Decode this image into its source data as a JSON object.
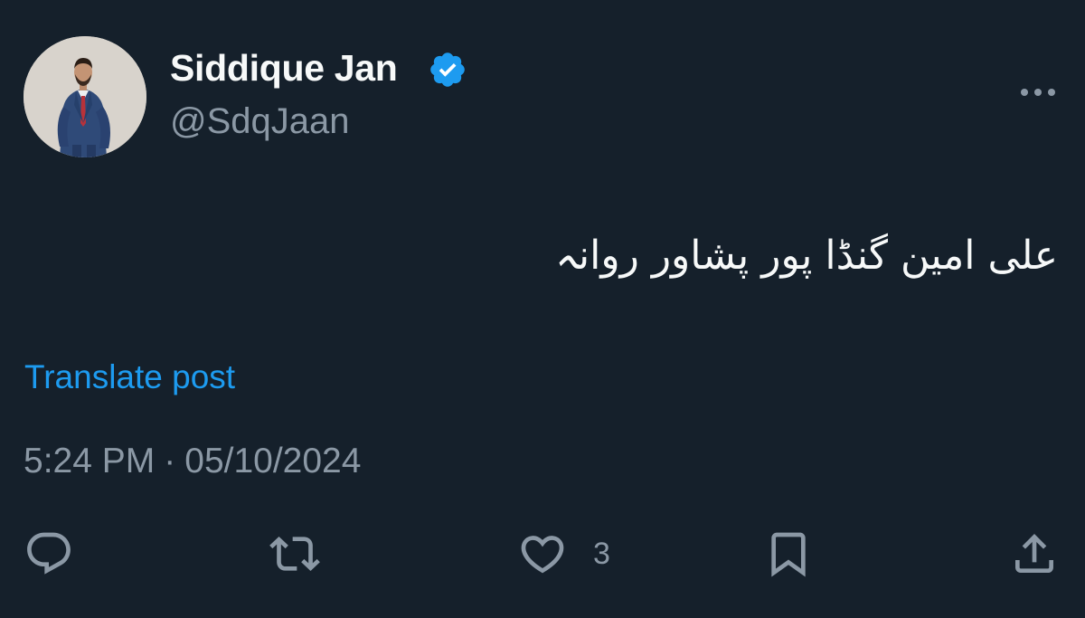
{
  "author": {
    "display_name": "Siddique Jan",
    "handle": "@SdqJaan",
    "verified": true,
    "verified_color": "#1d9bf0"
  },
  "post": {
    "text": "علی امین گنڈا پور پشاور روانہ",
    "translate_label": "Translate post",
    "time": "5:24 PM",
    "separator": "·",
    "date": "05/10/2024"
  },
  "actions": {
    "reply_icon": "speech-bubble-icon",
    "repost_icon": "repost-arrows-icon",
    "like_icon": "heart-icon",
    "like_count": "3",
    "bookmark_icon": "bookmark-icon",
    "share_icon": "share-upload-icon"
  },
  "colors": {
    "background": "#15202b",
    "primary_text": "#f7f9f9",
    "secondary_text": "#8b98a5",
    "link": "#1d9bf0"
  }
}
